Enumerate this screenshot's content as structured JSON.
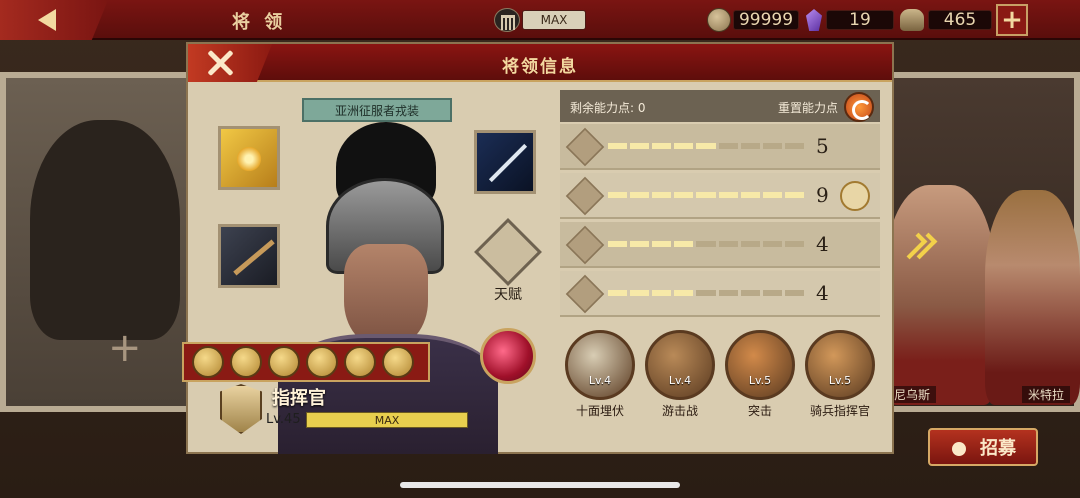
{
  "topbar": {
    "title": "将 领",
    "max_label": "MAX",
    "coins": "99999",
    "gems": "19",
    "helmets": "465"
  },
  "dialog": {
    "title": "将领信息",
    "costume_label": "亚洲征服者戎装",
    "talent_label": "天赋",
    "commander": {
      "name": "指挥官",
      "level": "Lv.45",
      "level_bar": "MAX",
      "level_progress": 1.0
    },
    "stats": {
      "remaining_label": "剩余能力点:",
      "remaining_value": "0",
      "reset_label": "重置能力点",
      "rows": [
        {
          "icon": "sword-icon",
          "value": "5",
          "filled": 5
        },
        {
          "icon": "horse-icon",
          "value": "9",
          "filled": 9
        },
        {
          "icon": "bow-icon",
          "value": "4",
          "filled": 4
        },
        {
          "icon": "anchor-icon",
          "value": "4",
          "filled": 4
        }
      ],
      "pips_total": 9
    },
    "abilities": [
      {
        "level": "Lv.4",
        "name": "十面埋伏",
        "color": "#d8cdb4"
      },
      {
        "level": "Lv.4",
        "name": "游击战",
        "color": "#b98a58"
      },
      {
        "level": "Lv.5",
        "name": "突击",
        "color": "#d28a4a"
      },
      {
        "level": "Lv.5",
        "name": "骑兵指挥官",
        "color": "#d2985a"
      }
    ]
  },
  "background": {
    "name_tag_left": "尼乌斯",
    "name_tag_right": "米特拉",
    "recruit_label": "招募"
  },
  "colors": {
    "banner_red": "#7a1512",
    "gold": "#c9a35f",
    "parchment": "#d9ccb0"
  }
}
